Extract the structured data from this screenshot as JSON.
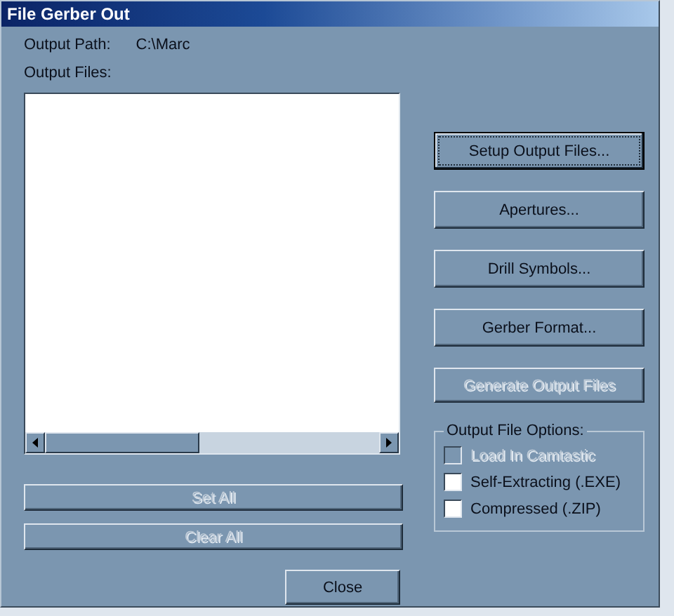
{
  "window": {
    "title": "File Gerber Out"
  },
  "output_path": {
    "label": "Output Path:",
    "value": "C:\\Marc"
  },
  "output_files": {
    "label": "Output Files:"
  },
  "buttons": [
    {
      "label": "Setup Output Files...",
      "disabled": false,
      "focused": true
    },
    {
      "label": "Apertures...",
      "disabled": false,
      "focused": false
    },
    {
      "label": "Drill Symbols...",
      "disabled": false,
      "focused": false
    },
    {
      "label": "Gerber Format...",
      "disabled": false,
      "focused": false
    },
    {
      "label": "Generate Output Files",
      "disabled": true,
      "focused": false
    }
  ],
  "options": {
    "title": "Output File Options:",
    "items": [
      {
        "label": "Load In Camtastic",
        "checked": false,
        "disabled": true
      },
      {
        "label": "Self-Extracting (.EXE)",
        "checked": false,
        "disabled": false
      },
      {
        "label": "Compressed (.ZIP)",
        "checked": false,
        "disabled": false
      }
    ]
  },
  "list_buttons": [
    {
      "label": "Set All",
      "disabled": true
    },
    {
      "label": "Clear All",
      "disabled": true
    }
  ],
  "close": {
    "label": "Close"
  }
}
